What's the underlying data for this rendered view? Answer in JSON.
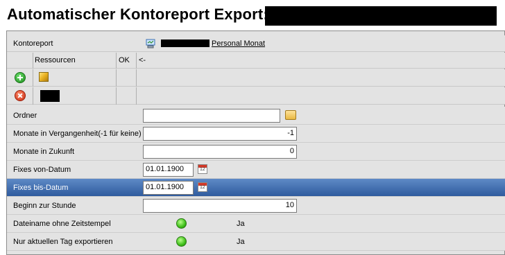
{
  "header": {
    "title": "Automatischer Kontoreport Export:"
  },
  "kontoreport": {
    "label": "Kontoreport",
    "link_text": "Personal Monat"
  },
  "grid": {
    "col_ressourcen": "Ressourcen",
    "col_ok": "OK",
    "col_arrow": "<-"
  },
  "fields": {
    "ordner": {
      "label": "Ordner",
      "value": ""
    },
    "vergangenheit": {
      "label": "Monate in Vergangenheit(-1 für keine)",
      "value": "-1"
    },
    "zukunft": {
      "label": "Monate in Zukunft",
      "value": "0"
    },
    "von_datum": {
      "label": "Fixes von-Datum",
      "value": "01.01.1900"
    },
    "bis_datum": {
      "label": "Fixes bis-Datum",
      "value": "01.01.1900"
    },
    "stunde": {
      "label": "Beginn zur Stunde",
      "value": "10"
    },
    "zeitstempel": {
      "label": "Dateiname ohne Zeitstempel",
      "value": "Ja"
    },
    "aktueller_tag": {
      "label": "Nur aktuellen Tag exportieren",
      "value": "Ja"
    }
  },
  "colors": {
    "selected_row": "#2f5b9e",
    "panel_bg": "#e3e3e3",
    "status_on": "#3fbf1a"
  }
}
